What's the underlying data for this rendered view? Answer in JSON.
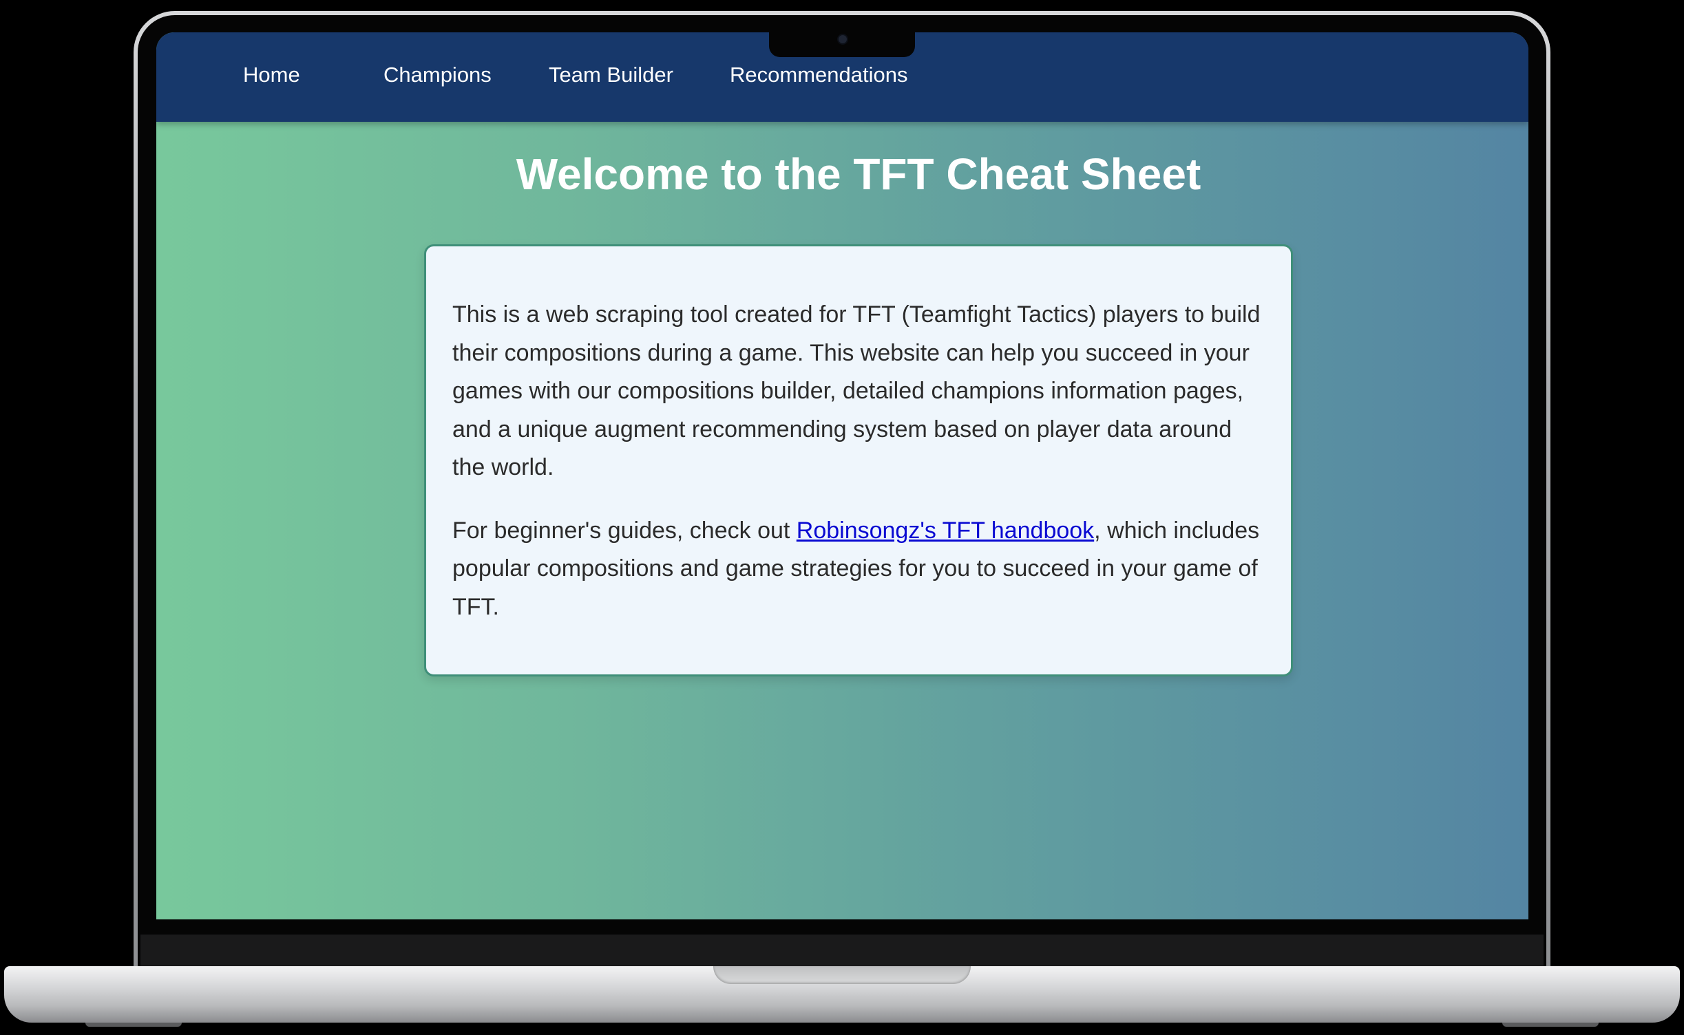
{
  "nav": {
    "items": [
      {
        "label": "Home"
      },
      {
        "label": "Champions"
      },
      {
        "label": "Team Builder"
      },
      {
        "label": "Recommendations"
      }
    ]
  },
  "main": {
    "title": "Welcome to the TFT Cheat Sheet",
    "intro": "This is a web scraping tool created for TFT (Teamfight Tactics) players to build their compositions during a game. This website can help you succeed in your games with our compositions builder, detailed champions information pages, and a unique augment recommending system based on player data around the world.",
    "guide_prefix": "For beginner's guides, check out ",
    "guide_link": "Robinsongz's TFT handbook",
    "guide_suffix": ", which includes popular compositions and game strategies for you to succeed in your game of TFT."
  },
  "colors": {
    "nav_background": "#17386b",
    "gradient_start": "#78c89c",
    "gradient_end": "#5485a3",
    "card_background": "#eff6fc",
    "card_border": "#3f8f79",
    "link": "#0a0ad2"
  }
}
